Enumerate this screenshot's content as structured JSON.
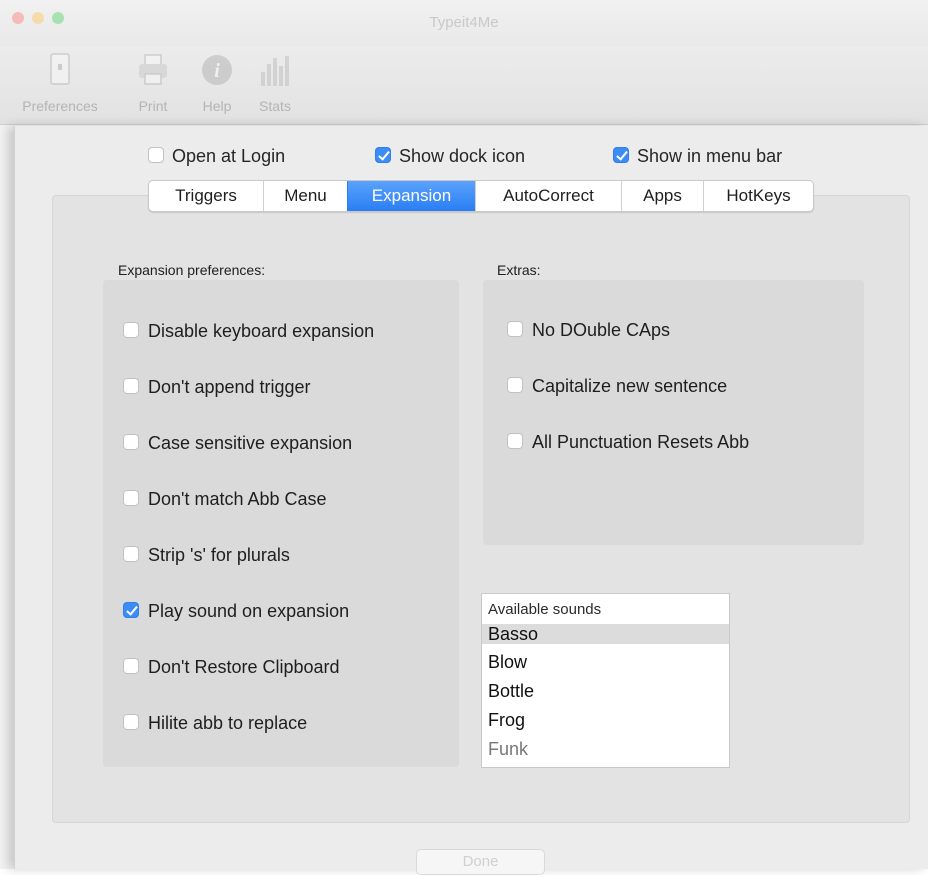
{
  "window": {
    "title": "Typeit4Me"
  },
  "toolbar": {
    "items": [
      {
        "label": "Preferences",
        "icon": "preferences-icon"
      },
      {
        "label": "Print",
        "icon": "printer-icon"
      },
      {
        "label": "Help",
        "icon": "info-icon"
      },
      {
        "label": "Stats",
        "icon": "bar-chart-icon"
      }
    ]
  },
  "top_options": {
    "open_at_login": {
      "label": "Open at Login",
      "checked": false
    },
    "show_dock_icon": {
      "label": "Show dock icon",
      "checked": true
    },
    "show_in_menu_bar": {
      "label": "Show in menu bar",
      "checked": true
    }
  },
  "tabs": [
    {
      "label": "Triggers",
      "active": false
    },
    {
      "label": "Menu",
      "active": false
    },
    {
      "label": "Expansion",
      "active": true
    },
    {
      "label": "AutoCorrect",
      "active": false
    },
    {
      "label": "Apps",
      "active": false
    },
    {
      "label": "HotKeys",
      "active": false
    }
  ],
  "expansion_prefs": {
    "title": "Expansion preferences:",
    "options": [
      {
        "label": "Disable keyboard expansion",
        "checked": false
      },
      {
        "label": "Don't append trigger",
        "checked": false
      },
      {
        "label": "Case sensitive expansion",
        "checked": false
      },
      {
        "label": "Don't match Abb Case",
        "checked": false
      },
      {
        "label": "Strip 's' for plurals",
        "checked": false
      },
      {
        "label": "Play sound on expansion",
        "checked": true
      },
      {
        "label": "Don't Restore Clipboard",
        "checked": false
      },
      {
        "label": "Hilite abb to replace",
        "checked": false
      }
    ]
  },
  "extras": {
    "title": "Extras:",
    "options": [
      {
        "label": "No DOuble CAps",
        "checked": false
      },
      {
        "label": "Capitalize new sentence",
        "checked": false
      },
      {
        "label": "All Punctuation Resets Abb",
        "checked": false
      }
    ]
  },
  "sounds": {
    "header": "Available sounds",
    "items": [
      "Basso",
      "Blow",
      "Bottle",
      "Frog",
      "Funk"
    ],
    "selected": "Basso"
  },
  "footer": {
    "done_label": "Done"
  },
  "colors": {
    "accent": "#2a7ef4",
    "checkbox_on": "#3b8cf5"
  }
}
